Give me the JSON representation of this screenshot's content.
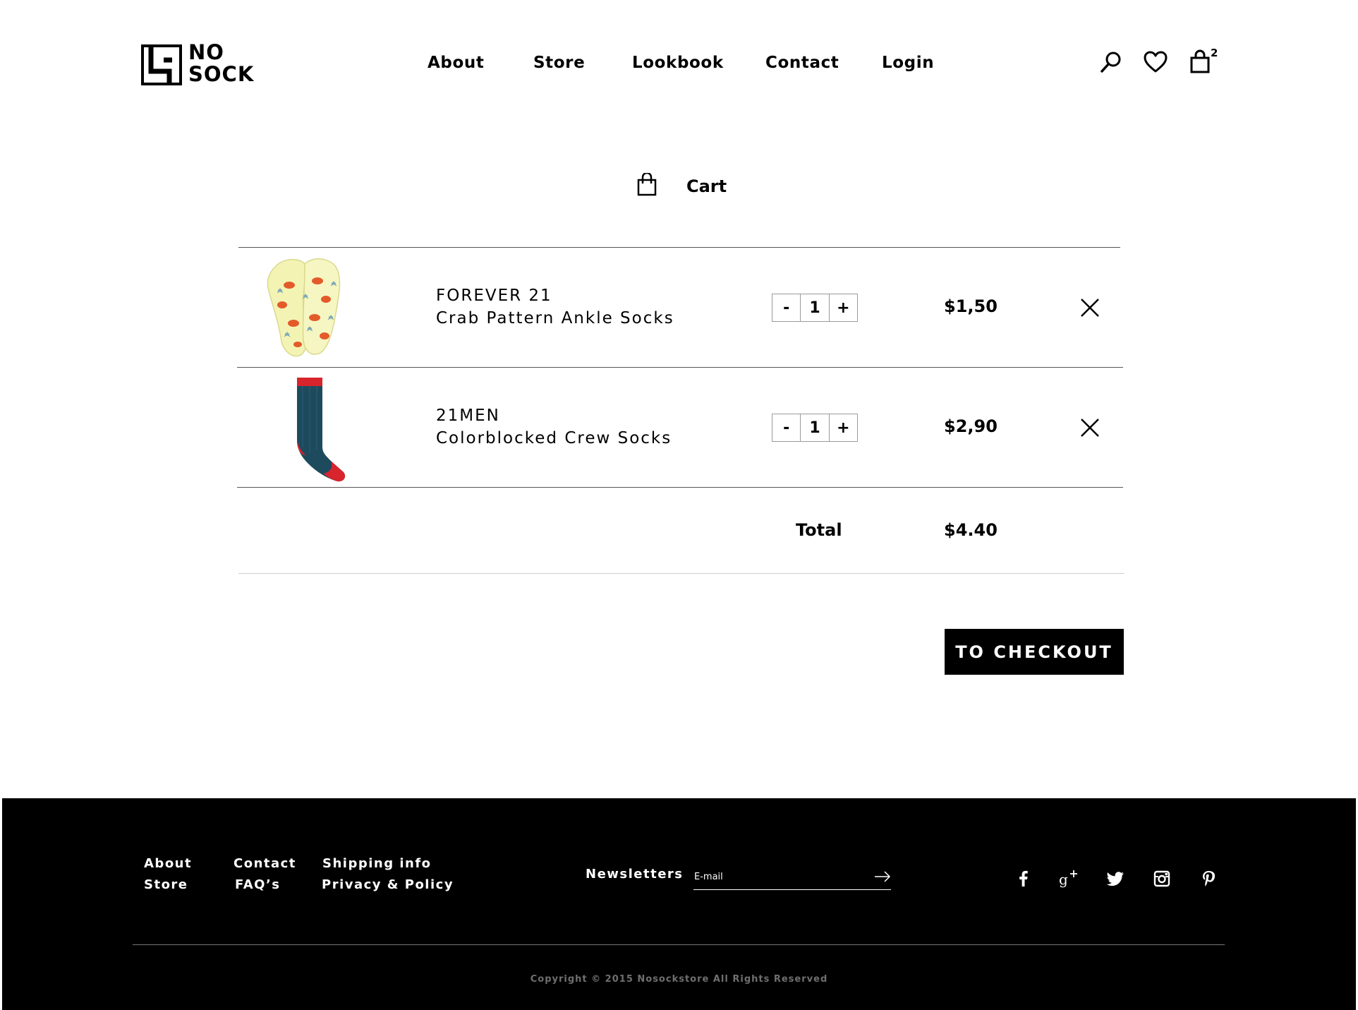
{
  "brand": {
    "logo_line1": "NO",
    "logo_line2": "SOCK"
  },
  "nav": {
    "items": [
      "About",
      "Store",
      "Lookbook",
      "Contact",
      "Login"
    ]
  },
  "header_icons": {
    "search": "search-icon",
    "wishlist": "heart-icon",
    "cart": "shopping-bag-icon",
    "cart_count": "2"
  },
  "cart": {
    "title": "Cart",
    "items": [
      {
        "brand": "FOREVER 21",
        "name": "Crab Pattern Ankle Socks",
        "quantity": "1",
        "price": "$1,50",
        "image": "yellow crab pattern ankle socks"
      },
      {
        "brand": "21MEN",
        "name": "Colorblocked Crew Socks",
        "quantity": "1",
        "price": "$2,90",
        "image": "teal crew sock with red toe and cuff"
      }
    ],
    "minus_label": "-",
    "plus_label": "+",
    "total_label": "Total",
    "total_value": "$4.40",
    "checkout_label": "TO CHECKOUT"
  },
  "footer": {
    "links_col1": [
      "About",
      "Store"
    ],
    "links_col2": [
      "Contact",
      "FAQ’s"
    ],
    "links_col3": [
      "Shipping info",
      "Privacy & Policy"
    ],
    "newsletter_label": "Newsletters",
    "email_placeholder": "E-mail",
    "social": [
      "facebook-icon",
      "google-plus-icon",
      "twitter-icon",
      "instagram-icon",
      "pinterest-icon"
    ],
    "copyright": "Copyright © 2015 Nosockstore All Rights Reserved"
  },
  "colors": {
    "background": "#ffffff",
    "footer_bg": "#000000",
    "text": "#000000",
    "copyright_text": "#6f6f6f"
  }
}
